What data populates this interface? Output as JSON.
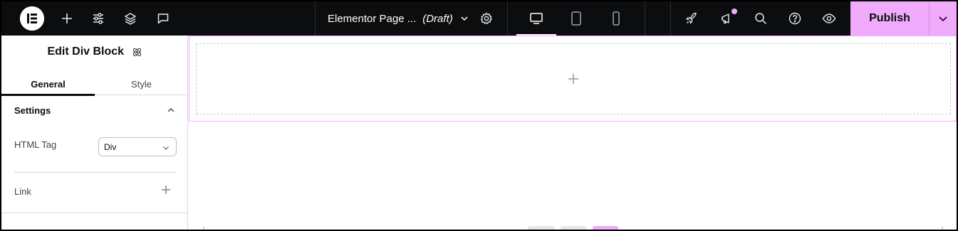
{
  "topbar": {
    "logo_icon": "elementor-logo-icon",
    "tools": [
      {
        "name": "add-element-button",
        "icon": "plus-icon"
      },
      {
        "name": "site-settings-button",
        "icon": "sliders-icon"
      },
      {
        "name": "structure-button",
        "icon": "layers-icon"
      },
      {
        "name": "notes-button",
        "icon": "comment-icon"
      }
    ],
    "document": {
      "title": "Elementor Page ...",
      "status": "(Draft)"
    },
    "devices": [
      "desktop",
      "tablet",
      "mobile"
    ],
    "active_device": "desktop",
    "right_tools": [
      {
        "name": "launchpad-button",
        "icon": "rocket-icon"
      },
      {
        "name": "whats-new-button",
        "icon": "megaphone-icon"
      },
      {
        "name": "finder-button",
        "icon": "search-icon"
      },
      {
        "name": "help-button",
        "icon": "help-icon"
      },
      {
        "name": "preview-button",
        "icon": "eye-icon"
      }
    ],
    "publish_label": "Publish",
    "accent_color": "#f0abfc"
  },
  "panel": {
    "title": "Edit Div Block",
    "tabs": [
      {
        "label": "General",
        "active": true
      },
      {
        "label": "Style",
        "active": false
      }
    ],
    "section": {
      "title": "Settings",
      "expanded": true
    },
    "html_tag": {
      "label": "HTML Tag",
      "value": "Div"
    },
    "link": {
      "label": "Link"
    }
  },
  "canvas": {
    "selected_outline_color": "#f0abfc"
  }
}
